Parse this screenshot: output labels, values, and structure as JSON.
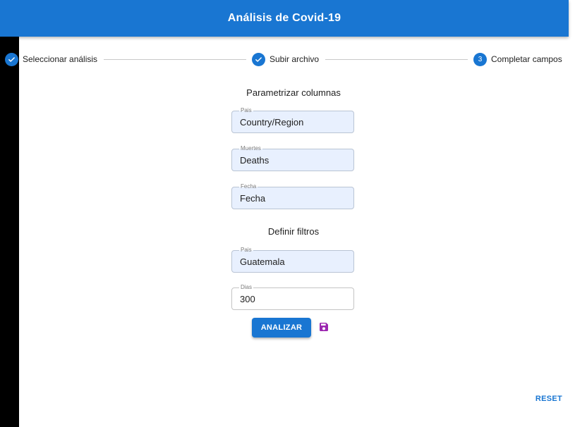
{
  "app_bar": {
    "title": "Análisis de Covid-19"
  },
  "stepper": {
    "steps": [
      {
        "label": "Seleccionar análisis",
        "state": "completed",
        "icon": "check-icon"
      },
      {
        "label": "Subir archivo",
        "state": "completed",
        "icon": "check-icon"
      },
      {
        "label": "Completar campos",
        "state": "active",
        "number": "3"
      }
    ]
  },
  "parametrizar": {
    "title": "Parametrizar columnas",
    "fields": [
      {
        "label": "Pais",
        "value": "Country/Region"
      },
      {
        "label": "Muertes",
        "value": "Deaths"
      },
      {
        "label": "Fecha",
        "value": "Fecha"
      }
    ]
  },
  "filtros": {
    "title": "Definir filtros",
    "fields": [
      {
        "label": "Pais",
        "value": "Guatemala"
      },
      {
        "label": "Dias",
        "value": "300"
      }
    ]
  },
  "actions": {
    "analizar_label": "ANALIZAR",
    "save_icon": "save-icon",
    "reset_label": "RESET"
  },
  "colors": {
    "primary": "#1976d2",
    "save_icon": "#9c27b0",
    "autofill_bg": "#e8f0fe"
  }
}
